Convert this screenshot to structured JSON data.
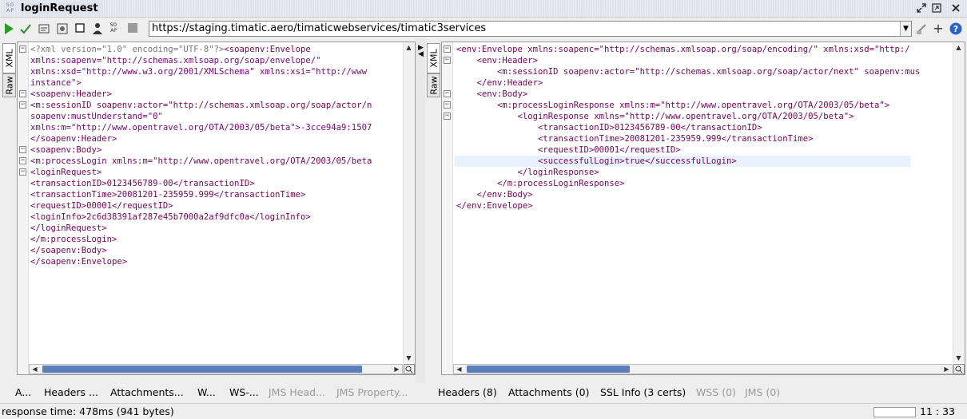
{
  "window": {
    "logo_top": "SO",
    "logo_bottom": "AP",
    "title": "loginRequest"
  },
  "toolbar": {
    "url": "https://staging.timatic.aero/timaticwebservices/timatic3services"
  },
  "request_pane": {
    "tabs": [
      "XML",
      "Raw"
    ],
    "lines": [
      {
        "k": "decl",
        "text": "<?xml version=\"1.0\" encoding=\"UTF-8\"?>",
        "rest": "<soapenv:Envelope"
      },
      {
        "k": "attr",
        "text": "xmlns:soapenv=\"http://schemas.xmlsoap.org/soap/envelope/\""
      },
      {
        "k": "attr",
        "text": "xmlns:xsd=\"http://www.w3.org/2001/XMLSchema\" xmlns:xsi=\"http://www"
      },
      {
        "k": "attr",
        "text": "instance\">"
      },
      {
        "k": "tag",
        "text": "<soapenv:Header>"
      },
      {
        "k": "tag",
        "text": "<m:sessionID soapenv:actor=\"http://schemas.xmlsoap.org/soap/actor/n"
      },
      {
        "k": "attr",
        "text": "soapenv:mustUnderstand=\"0\""
      },
      {
        "k": "attr",
        "text": "xmlns:m=\"http://www.opentravel.org/OTA/2003/05/beta\">-3cce94a9:1507"
      },
      {
        "k": "tag",
        "text": "</soapenv:Header>"
      },
      {
        "k": "tag",
        "text": "<soapenv:Body>"
      },
      {
        "k": "tag",
        "text": "<m:processLogin xmlns:m=\"http://www.opentravel.org/OTA/2003/05/beta"
      },
      {
        "k": "tag",
        "text": "<loginRequest>"
      },
      {
        "k": "tag",
        "text": "<transactionID>0123456789-00</transactionID>"
      },
      {
        "k": "tag",
        "text": "<transactionTime>20081201-235959.999</transactionTime>"
      },
      {
        "k": "tag",
        "text": "<requestID>00001</requestID>"
      },
      {
        "k": "tag",
        "text": "<loginInfo>2c6d38391af287e45b7000a2af9dfc0a</loginInfo>"
      },
      {
        "k": "tag",
        "text": "</loginRequest>"
      },
      {
        "k": "tag",
        "text": "</m:processLogin>"
      },
      {
        "k": "tag",
        "text": "</soapenv:Body>"
      },
      {
        "k": "tag",
        "text": "</soapenv:Envelope>"
      }
    ],
    "bottom_tabs": [
      "A...",
      "Headers ...",
      "Attachments...",
      "W...",
      "WS-...",
      "JMS Head...",
      "JMS Property..."
    ]
  },
  "response_pane": {
    "tabs": [
      "XML",
      "Raw"
    ],
    "lines": [
      {
        "text": "<env:Envelope xmlns:soapenc=\"http://schemas.xmlsoap.org/soap/encoding/\" xmlns:xsd=\"http:/"
      },
      {
        "text": "    <env:Header>"
      },
      {
        "text": "        <m:sessionID soapenv:actor=\"http://schemas.xmlsoap.org/soap/actor/next\" soapenv:mus"
      },
      {
        "text": "    </env:Header>"
      },
      {
        "text": "    <env:Body>"
      },
      {
        "text": "        <m:processLoginResponse xmlns:m=\"http://www.opentravel.org/OTA/2003/05/beta\">"
      },
      {
        "text": "            <loginResponse xmlns=\"http://www.opentravel.org/OTA/2003/05/beta\">"
      },
      {
        "text": "                <transactionID>0123456789-00</transactionID>"
      },
      {
        "text": "                <transactionTime>20081201-235959.999</transactionTime>"
      },
      {
        "text": "                <requestID>00001</requestID>"
      },
      {
        "text": "                <successfulLogin>true</successfulLogin>"
      },
      {
        "text": "            </loginResponse>"
      },
      {
        "text": "        </m:processLoginResponse>"
      },
      {
        "text": "    </env:Body>"
      },
      {
        "text": "</env:Envelope>"
      }
    ],
    "bottom_tabs": [
      "Headers (8)",
      "Attachments (0)",
      "SSL Info (3 certs)",
      "WSS (0)",
      "JMS (0)"
    ]
  },
  "status": {
    "response_time": "response time: 478ms (941 bytes)",
    "cursor_position": "11 : 33"
  }
}
